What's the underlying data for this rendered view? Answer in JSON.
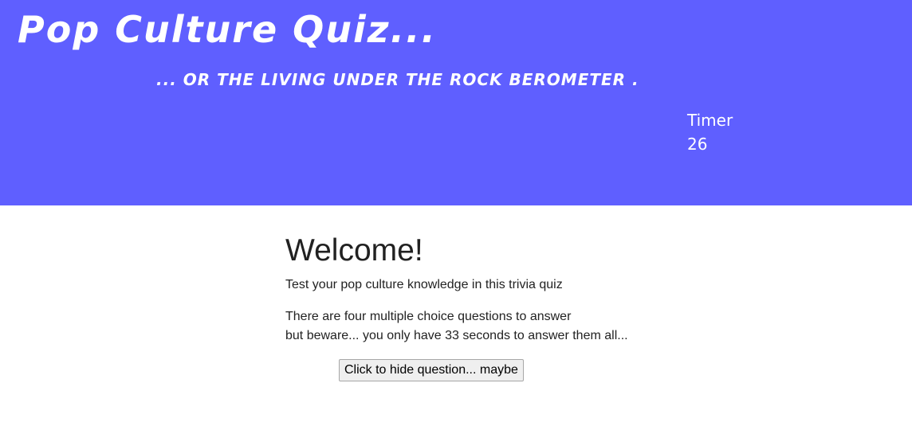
{
  "header": {
    "title": "Pop Culture Quiz...",
    "subtitle": "... or the living under the rock berometer .",
    "timer_label": "Timer",
    "timer_value": "26"
  },
  "main": {
    "heading": "Welcome!",
    "intro": "Test your pop culture knowledge in this trivia quiz",
    "rules_line1": "There are four multiple choice questions to answer",
    "rules_line2": "but beware... you only have 33 seconds to answer them all...",
    "hide_button_label": "Click to hide question... maybe"
  },
  "colors": {
    "header_bg": "#5f5fff",
    "header_text": "#ffffff"
  }
}
